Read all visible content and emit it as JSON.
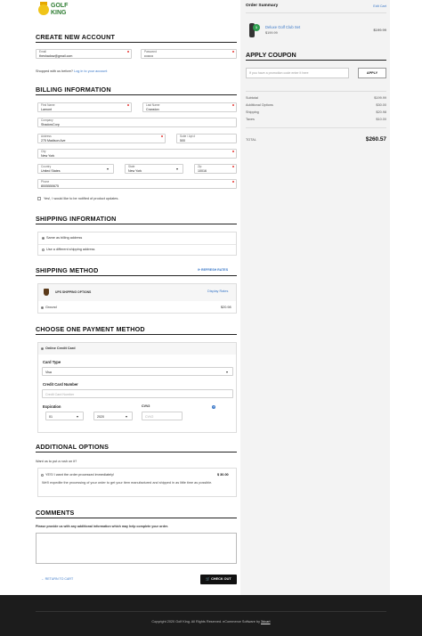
{
  "brand": {
    "line1": "GOLF",
    "line2": "KING"
  },
  "account": {
    "heading": "CREATE NEW ACCOUNT",
    "email_label": "Email",
    "email_value": "theshadow@gmail.com",
    "password_label": "Password",
    "password_value": "••••••••",
    "shopped_text": "Shopped with us before?",
    "login_link": "Log in to your account"
  },
  "billing": {
    "heading": "BILLING INFORMATION",
    "first_name_label": "First Name",
    "first_name": "Lamont",
    "last_name_label": "Last Name",
    "last_name": "Cranston",
    "company_label": "Company",
    "company": "ShadowCorp",
    "address_label": "Address",
    "address": "275 Madison Ave",
    "suite_label": "Suite / Apt #",
    "suite": "500",
    "city_label": "City",
    "city": "New York",
    "country_label": "Country",
    "country": "United States",
    "state_label": "State",
    "state": "New York",
    "zip_label": "Zip",
    "zip": "10016",
    "phone_label": "Phone",
    "phone": "8005550675",
    "notify_label": "Yes!, I would like to be notified of product updates."
  },
  "shipping_info": {
    "heading": "SHIPPING INFORMATION",
    "option_same": "Same as billing address",
    "option_different": "Use a different shipping address"
  },
  "shipping_method": {
    "heading": "SHIPPING METHOD",
    "refresh_label": "REFRESH RATES",
    "carrier_label": "UPS SHIPPING OPTIONS",
    "display_rates": "Display Rates",
    "option_name": "Ground",
    "option_price": "$20.98"
  },
  "payment": {
    "heading": "CHOOSE ONE PAYMENT METHOD",
    "method_label": "Online Credit Card",
    "card_type_label": "Card Type",
    "card_type": "Visa",
    "card_number_label": "Credit Card Number",
    "card_number_placeholder": "Credit Card Number",
    "expiration_label": "Expiration",
    "exp_month": "01",
    "exp_year": "2020",
    "cvv_label": "CVV2",
    "cvv_placeholder": "CVV2"
  },
  "additional": {
    "heading": "ADDITIONAL OPTIONS",
    "question": "Want us to put a rush on it?",
    "option_label": "YES! I want the order processed immediately!",
    "option_price": "$ 30.00",
    "option_desc": "We'll expedite the processing of your order to get your item manufactured and shipped in as little time as possible."
  },
  "comments": {
    "heading": "COMMENTS",
    "prompt": "Please provide us with any additional information which may help complete your order."
  },
  "actions": {
    "return_label": "RETURN TO CART",
    "checkout_label": "CHECK OUT"
  },
  "summary": {
    "title": "Order Summary",
    "edit_cart": "Edit Cart",
    "item_qty": "1",
    "item_name": "Deluxe Golf Club Set",
    "item_unit_price": "$199.99",
    "item_total": "$199.99",
    "coupon_heading": "APPLY COUPON",
    "coupon_placeholder": "If you have a promotion code enter it here",
    "apply_label": "APPLY",
    "subtotal_label": "Subtotal",
    "subtotal": "$199.99",
    "additional_label": "Additional Options",
    "additional": "$30.00",
    "shipping_label": "Shipping",
    "shipping": "$20.98",
    "taxes_label": "Taxes",
    "taxes": "$10.00",
    "total_label": "TOTAL",
    "total": "$260.57"
  },
  "footer": {
    "copyright": "Copyright 2020 Golf King. All Rights Reserved. eCommerce Software by",
    "software_link": "3dcart"
  },
  "colors": {
    "accent": "#3a78c8",
    "required": "#e53935",
    "dark": "#111111",
    "footer": "#1c1c1c"
  }
}
